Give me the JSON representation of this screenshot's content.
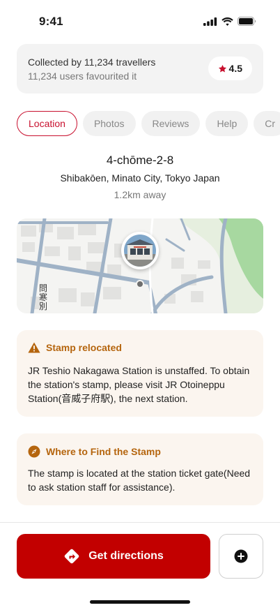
{
  "status": {
    "time": "9:41"
  },
  "summary": {
    "collected_text": "Collected by 11,234 travellers",
    "favourited_text": "11,234 users favourited it",
    "rating": "4.5"
  },
  "tabs": [
    {
      "label": "Location",
      "active": true
    },
    {
      "label": "Photos",
      "active": false
    },
    {
      "label": "Reviews",
      "active": false
    },
    {
      "label": "Help",
      "active": false
    },
    {
      "label": "Cr",
      "active": false
    }
  ],
  "address": {
    "main": "4-chōme-2-8",
    "sub": "Shibakōen, Minato City, Tokyo Japan",
    "distance": "1.2km away"
  },
  "map": {
    "label": "問寒別"
  },
  "notices": [
    {
      "title": "Stamp relocated",
      "icon": "warning-icon",
      "body": "JR Teshio Nakagawa Station is unstaffed. To obtain the station's stamp, please visit JR Otoineppu Station(音威子府駅), the next station."
    },
    {
      "title": "Where to Find the Stamp",
      "icon": "compass-icon",
      "body": "The stamp is located at the station ticket gate(Need to ask station staff for assistance)."
    }
  ],
  "actions": {
    "directions_label": "Get directions",
    "add_icon": "plus-circle-icon"
  },
  "colors": {
    "accent": "#c20000",
    "notice_title": "#b5650e",
    "notice_bg": "#fbf5ef",
    "rating_star": "#c8102e"
  }
}
